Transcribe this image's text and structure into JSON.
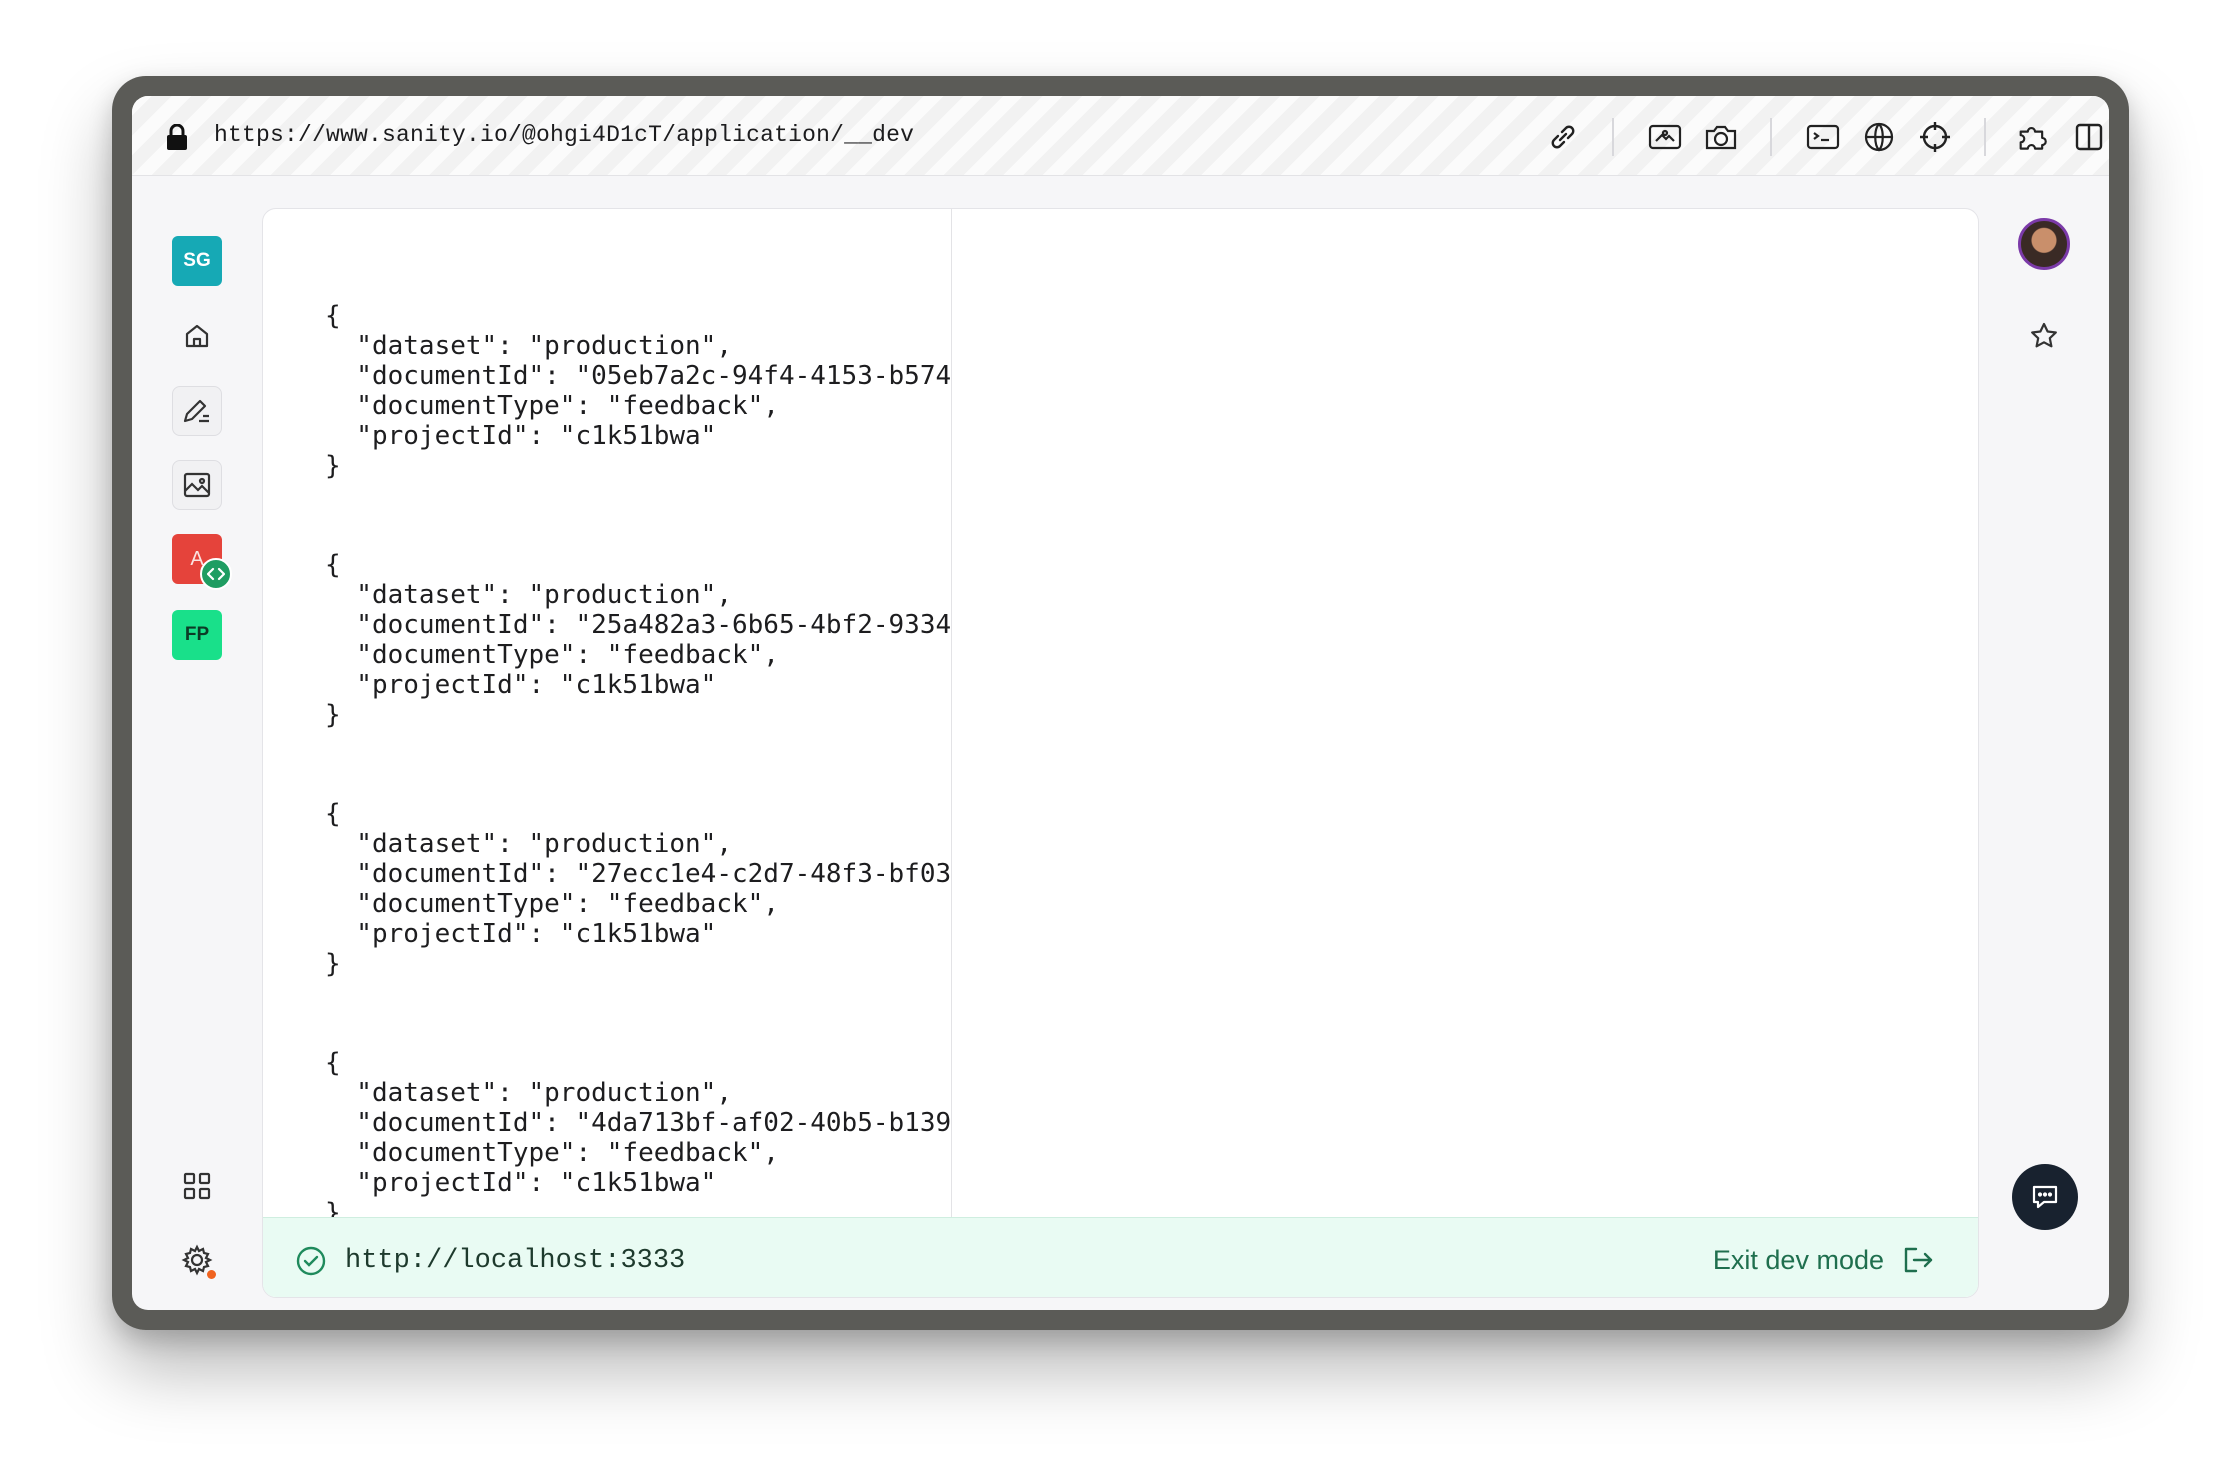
{
  "browser": {
    "url": "https://www.sanity.io/@ohgi4D1cT/application/__dev"
  },
  "sidebar": {
    "workspace_badge": "SG",
    "apps": [
      {
        "label": "A",
        "color": "#e5433b",
        "dev": true
      },
      {
        "label": "FP",
        "color": "#19e08a"
      }
    ]
  },
  "documents": [
    {
      "open": "{",
      "dataset": "  \"dataset\": \"production\",",
      "documentId": "  \"documentId\": \"05eb7a2c-94f4-4153-b574",
      "documentType": "  \"documentType\": \"feedback\",",
      "projectId": "  \"projectId\": \"c1k51bwa\"",
      "close": "}"
    },
    {
      "open": "{",
      "dataset": "  \"dataset\": \"production\",",
      "documentId": "  \"documentId\": \"25a482a3-6b65-4bf2-9334",
      "documentType": "  \"documentType\": \"feedback\",",
      "projectId": "  \"projectId\": \"c1k51bwa\"",
      "close": "}"
    },
    {
      "open": "{",
      "dataset": "  \"dataset\": \"production\",",
      "documentId": "  \"documentId\": \"27ecc1e4-c2d7-48f3-bf03",
      "documentType": "  \"documentType\": \"feedback\",",
      "projectId": "  \"projectId\": \"c1k51bwa\"",
      "close": "}"
    },
    {
      "open": "{",
      "dataset": "  \"dataset\": \"production\",",
      "documentId": "  \"documentId\": \"4da713bf-af02-40b5-b139",
      "documentType": "  \"documentType\": \"feedback\",",
      "projectId": "  \"projectId\": \"c1k51bwa\"",
      "close": "}"
    }
  ],
  "devbar": {
    "url": "http://localhost:3333",
    "exit_label": "Exit dev mode"
  },
  "colors": {
    "accent_green": "#1f6f4e",
    "workspace_teal": "#16a9b5"
  }
}
